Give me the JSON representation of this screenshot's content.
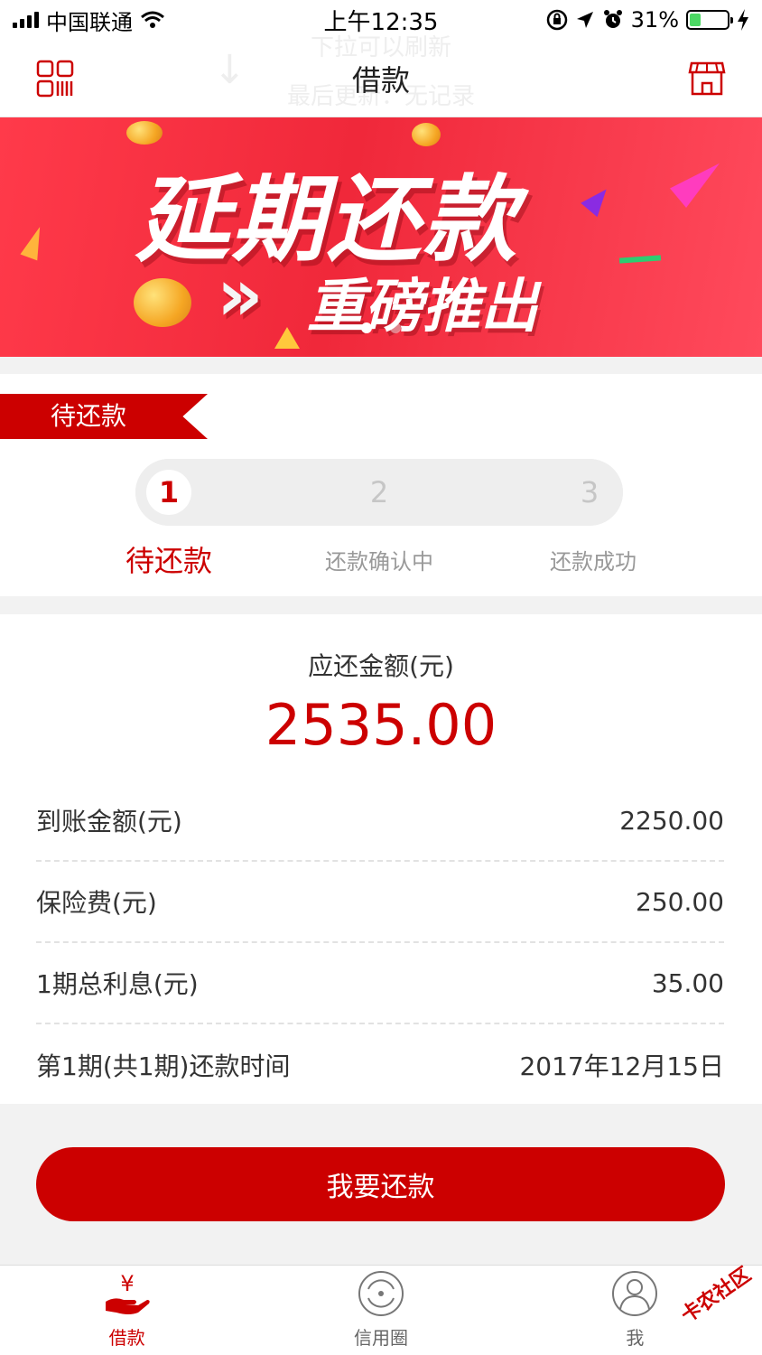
{
  "status_bar": {
    "carrier": "中国联通",
    "time": "上午12:35",
    "battery_percent": "31%",
    "battery_level": 0.31
  },
  "nav": {
    "title": "借款",
    "pull_hint_line1": "下拉可以刷新",
    "pull_hint_line2": "最后更新：无记录",
    "left_icon": "scan-icon",
    "right_icon": "shop-icon"
  },
  "banner": {
    "headline": "延期还款",
    "subline": "重磅推出",
    "chevrons": "»",
    "slide_count": 2,
    "active_slide": 1
  },
  "repay_section": {
    "ribbon": "待还款",
    "steps": [
      {
        "number": "1",
        "label": "待还款",
        "active": true
      },
      {
        "number": "2",
        "label": "还款确认中",
        "active": false
      },
      {
        "number": "3",
        "label": "还款成功",
        "active": false
      }
    ]
  },
  "amount": {
    "label": "应还金额(元)",
    "value": "2535.00",
    "rows": [
      {
        "label": "到账金额(元)",
        "value": "2250.00"
      },
      {
        "label": "保险费(元)",
        "value": "250.00"
      },
      {
        "label": "1期总利息(元)",
        "value": "35.00"
      },
      {
        "label": "第1期(共1期)还款时间",
        "value": "2017年12月15日"
      }
    ]
  },
  "repay_button": "我要还款",
  "tabs": [
    {
      "label": "借款",
      "icon": "yen-hand-icon",
      "active": true
    },
    {
      "label": "信用圈",
      "icon": "credit-circle-icon",
      "active": false
    },
    {
      "label": "我",
      "icon": "user-icon",
      "active": false
    }
  ],
  "watermark": "卡农社区",
  "colors": {
    "accent": "#cc0000",
    "banner": "#f0283a",
    "battery": "#4cd964"
  }
}
